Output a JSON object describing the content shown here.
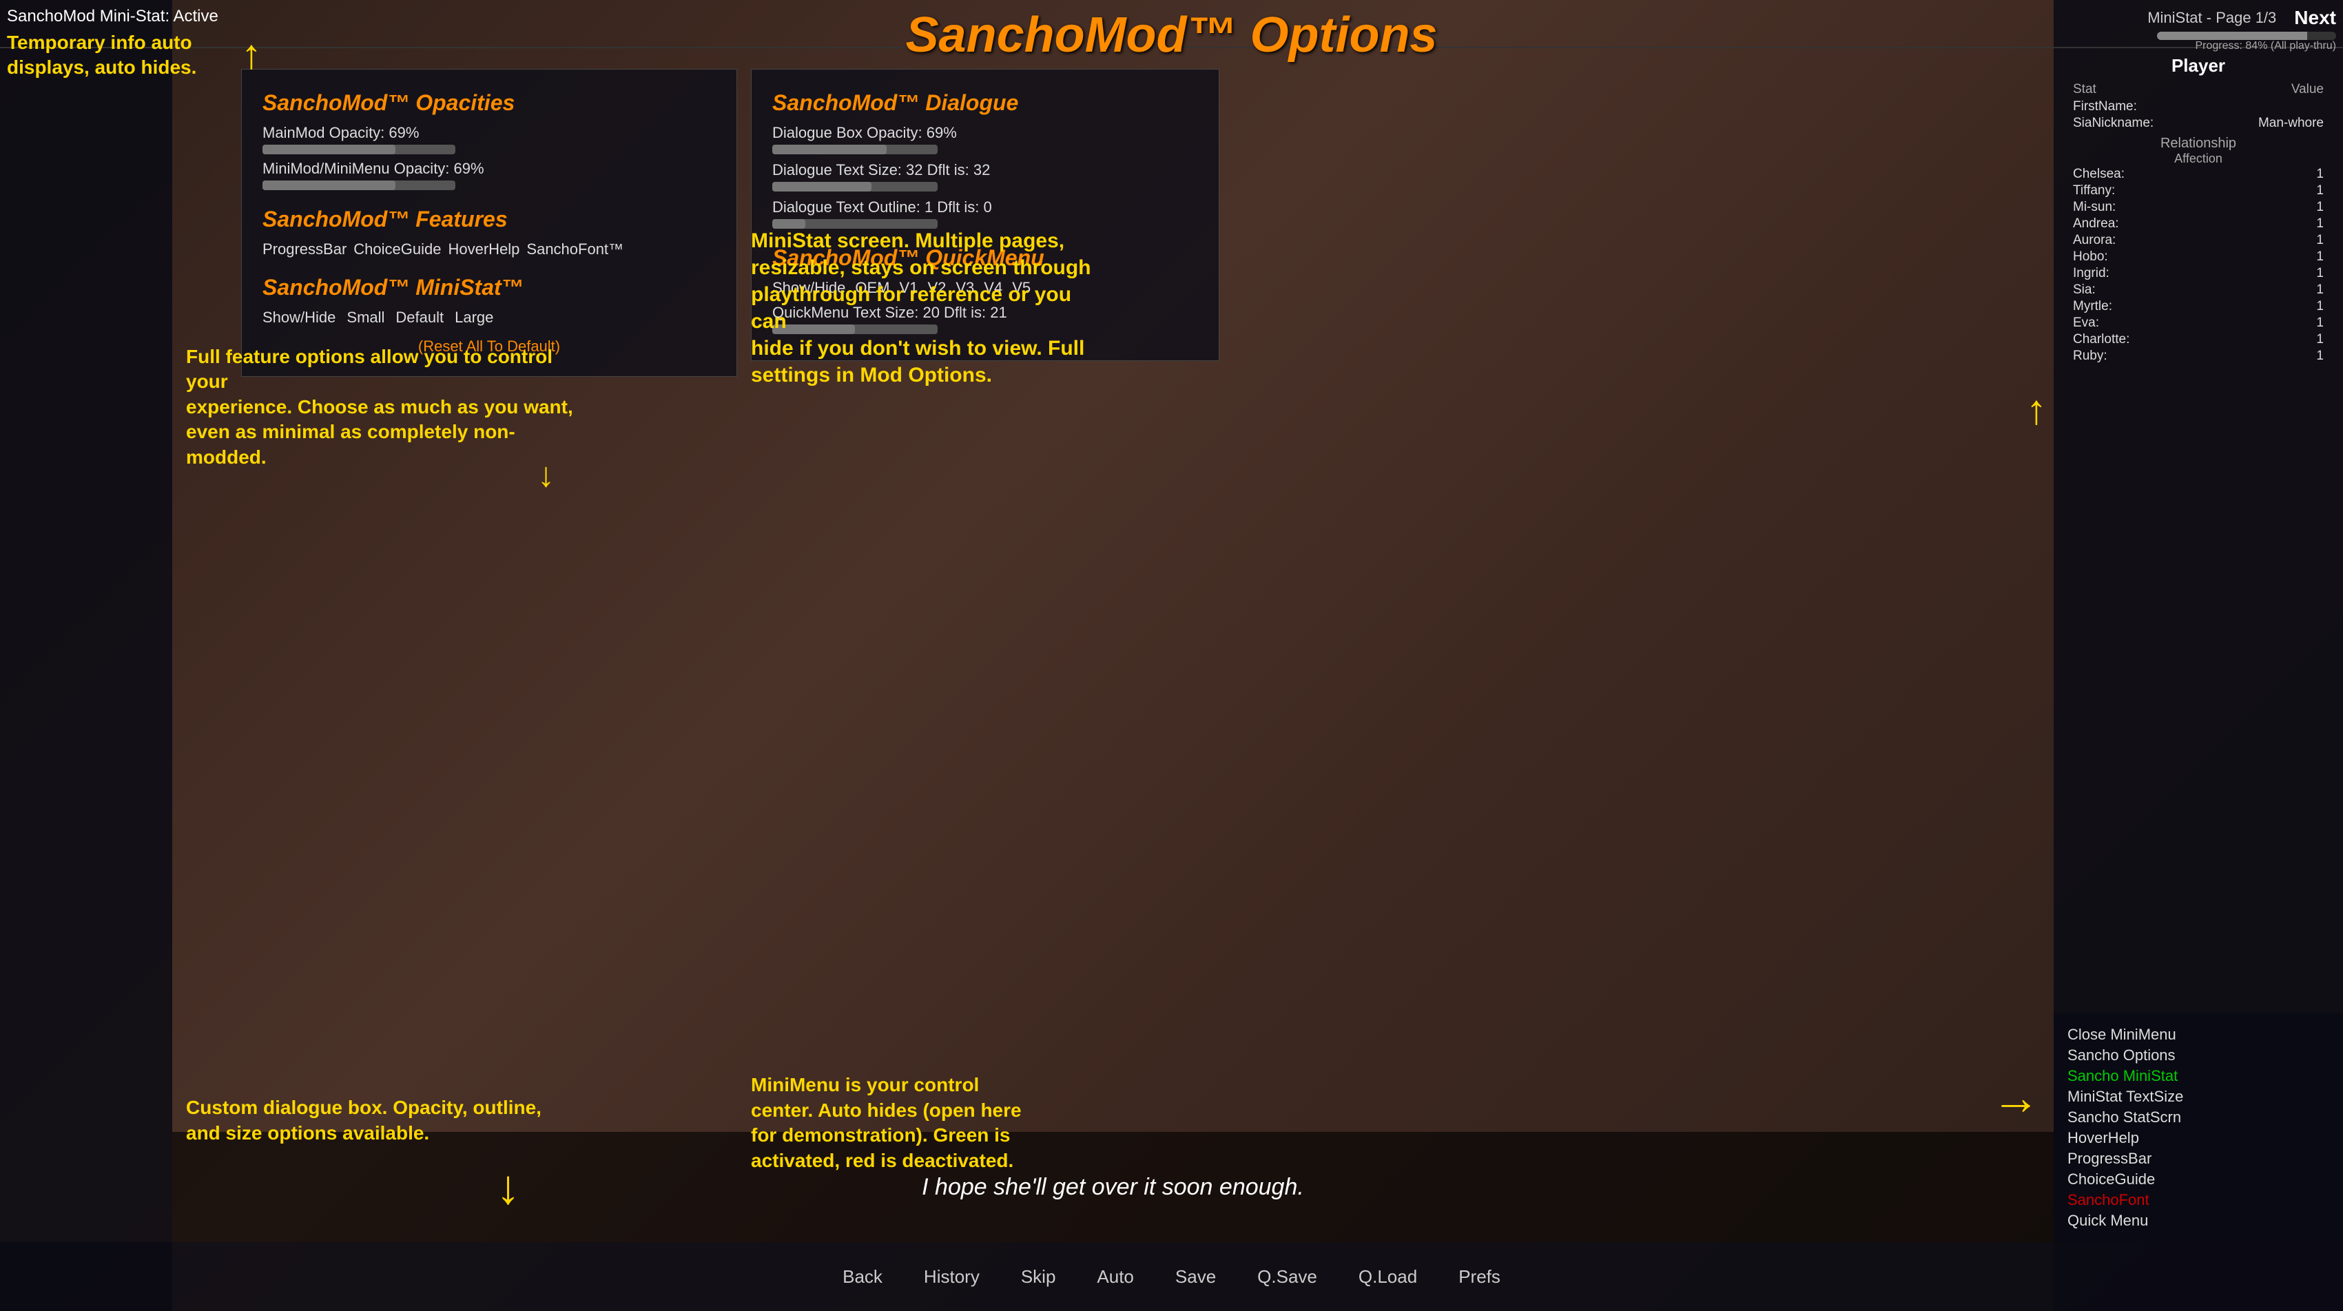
{
  "title": "SanchoMod™ Options",
  "titleSuperscript": "™",
  "topLeft": {
    "ministatActive": "SanchoMod Mini-Stat: Active"
  },
  "ministatHeader": {
    "label": "MiniStat - Page 1/3",
    "nextLabel": "Next",
    "progressLabel": "Progress: 84% (All play-thru)"
  },
  "annotations": {
    "topLeftAnnotation": "Temporary info auto\ndisplays, auto hides.",
    "centerAnnotation": "Full feature options allow you to control your\nexperience. Choose as much as you want,\neven as minimal as completely non-modded.",
    "bottomLeftAnnotation": "Custom dialogue box. Opacity, outline,\nand size options available.",
    "rightAnnotation": "MiniStat screen. Multiple pages,\nresizable, stays on screen through\nplaythrough for reference or you can\nhide if you don't wish to view. Full\nsettings in Mod Options.",
    "bottomRightAnnotation": "MiniMenu is your control\ncenter. Auto hides (open here\nfor demonstration). Green is\nactivated, red is deactivated."
  },
  "opacitiesSection": {
    "title": "SanchoMod™ Opacities",
    "mainmodOpacityLabel": "MainMod Opacity: 69%",
    "mainmodOpacityValue": 69,
    "minimodOpacityLabel": "MiniMod/MiniMenu Opacity: 69%",
    "minimodOpacityValue": 69
  },
  "featuresSection": {
    "title": "SanchoMod™ Features",
    "buttons": [
      "ProgressBar",
      "ChoiceGuide",
      "HoverHelp",
      "SanchoFont™"
    ]
  },
  "ministatSection": {
    "title": "SanchoMod™ MiniStat™",
    "showHideLabel": "Show/Hide",
    "sizes": [
      "Small",
      "Default",
      "Large"
    ]
  },
  "dialogueSection": {
    "title": "SanchoMod™ Dialogue",
    "dialogueBoxOpacityLabel": "Dialogue Box Opacity: 69%",
    "dialogueBoxOpacityValue": 69,
    "dialogueTextSizeLabel": "Dialogue Text Size: 32  Dflt is: 32",
    "dialogueTextSizeValue": 60,
    "dialogueTextOutlineLabel": "Dialogue Text Outline: 1  Dflt is: 0",
    "dialogueTextOutlineValue": 20
  },
  "quickMenuSection": {
    "title": "SanchoMod™ QuickMenu",
    "showHideLabel": "Show/Hide",
    "versions": [
      "OEM",
      "V1",
      "V2",
      "V3",
      "V4",
      "V5"
    ],
    "textSizeLabel": "QuickMenu Text Size: 20  Dflt is: 21",
    "textSizeValue": 50
  },
  "resetLabel": "(Reset All To Default)",
  "playerPanel": {
    "title": "Player",
    "statLabel": "Stat",
    "valueLabel": "Value",
    "stats": [
      {
        "name": "FirstName:",
        "value": ""
      },
      {
        "name": "SiaNickname:",
        "value": "Man-whore"
      }
    ],
    "relationshipTitle": "Relationship",
    "affectionLabel": "Affection",
    "characters": [
      {
        "name": "Chelsea:",
        "value": "1"
      },
      {
        "name": "Tiffany:",
        "value": "1"
      },
      {
        "name": "Mi-sun:",
        "value": "1"
      },
      {
        "name": "Andrea:",
        "value": "1"
      },
      {
        "name": "Aurora:",
        "value": "1"
      },
      {
        "name": "Hobo:",
        "value": "1"
      },
      {
        "name": "Ingrid:",
        "value": "1"
      },
      {
        "name": "Sia:",
        "value": "1"
      },
      {
        "name": "Myrtle:",
        "value": "1"
      },
      {
        "name": "Eva:",
        "value": "1"
      },
      {
        "name": "Charlotte:",
        "value": "1"
      },
      {
        "name": "Ruby:",
        "value": "1"
      }
    ]
  },
  "dialogueQuote": "I hope she'll get over it soon enough.",
  "bottomButtons": [
    "Back",
    "History",
    "Skip",
    "Auto",
    "Save",
    "Q.Save",
    "Q.Load",
    "Prefs"
  ],
  "miniMenu": {
    "items": [
      {
        "label": "Close MiniMenu",
        "style": "normal"
      },
      {
        "label": "Sancho Options",
        "style": "normal"
      },
      {
        "label": "Sancho MiniStat",
        "style": "highlighted"
      },
      {
        "label": "MiniStat TextSize",
        "style": "normal"
      },
      {
        "label": "Sancho StatScrn",
        "style": "normal"
      },
      {
        "label": "HoverHelp",
        "style": "normal"
      },
      {
        "label": "ProgressBar",
        "style": "normal"
      },
      {
        "label": "ChoiceGuide",
        "style": "normal"
      },
      {
        "label": "SanchoFont",
        "style": "red"
      },
      {
        "label": "Quick Menu",
        "style": "normal"
      }
    ]
  }
}
